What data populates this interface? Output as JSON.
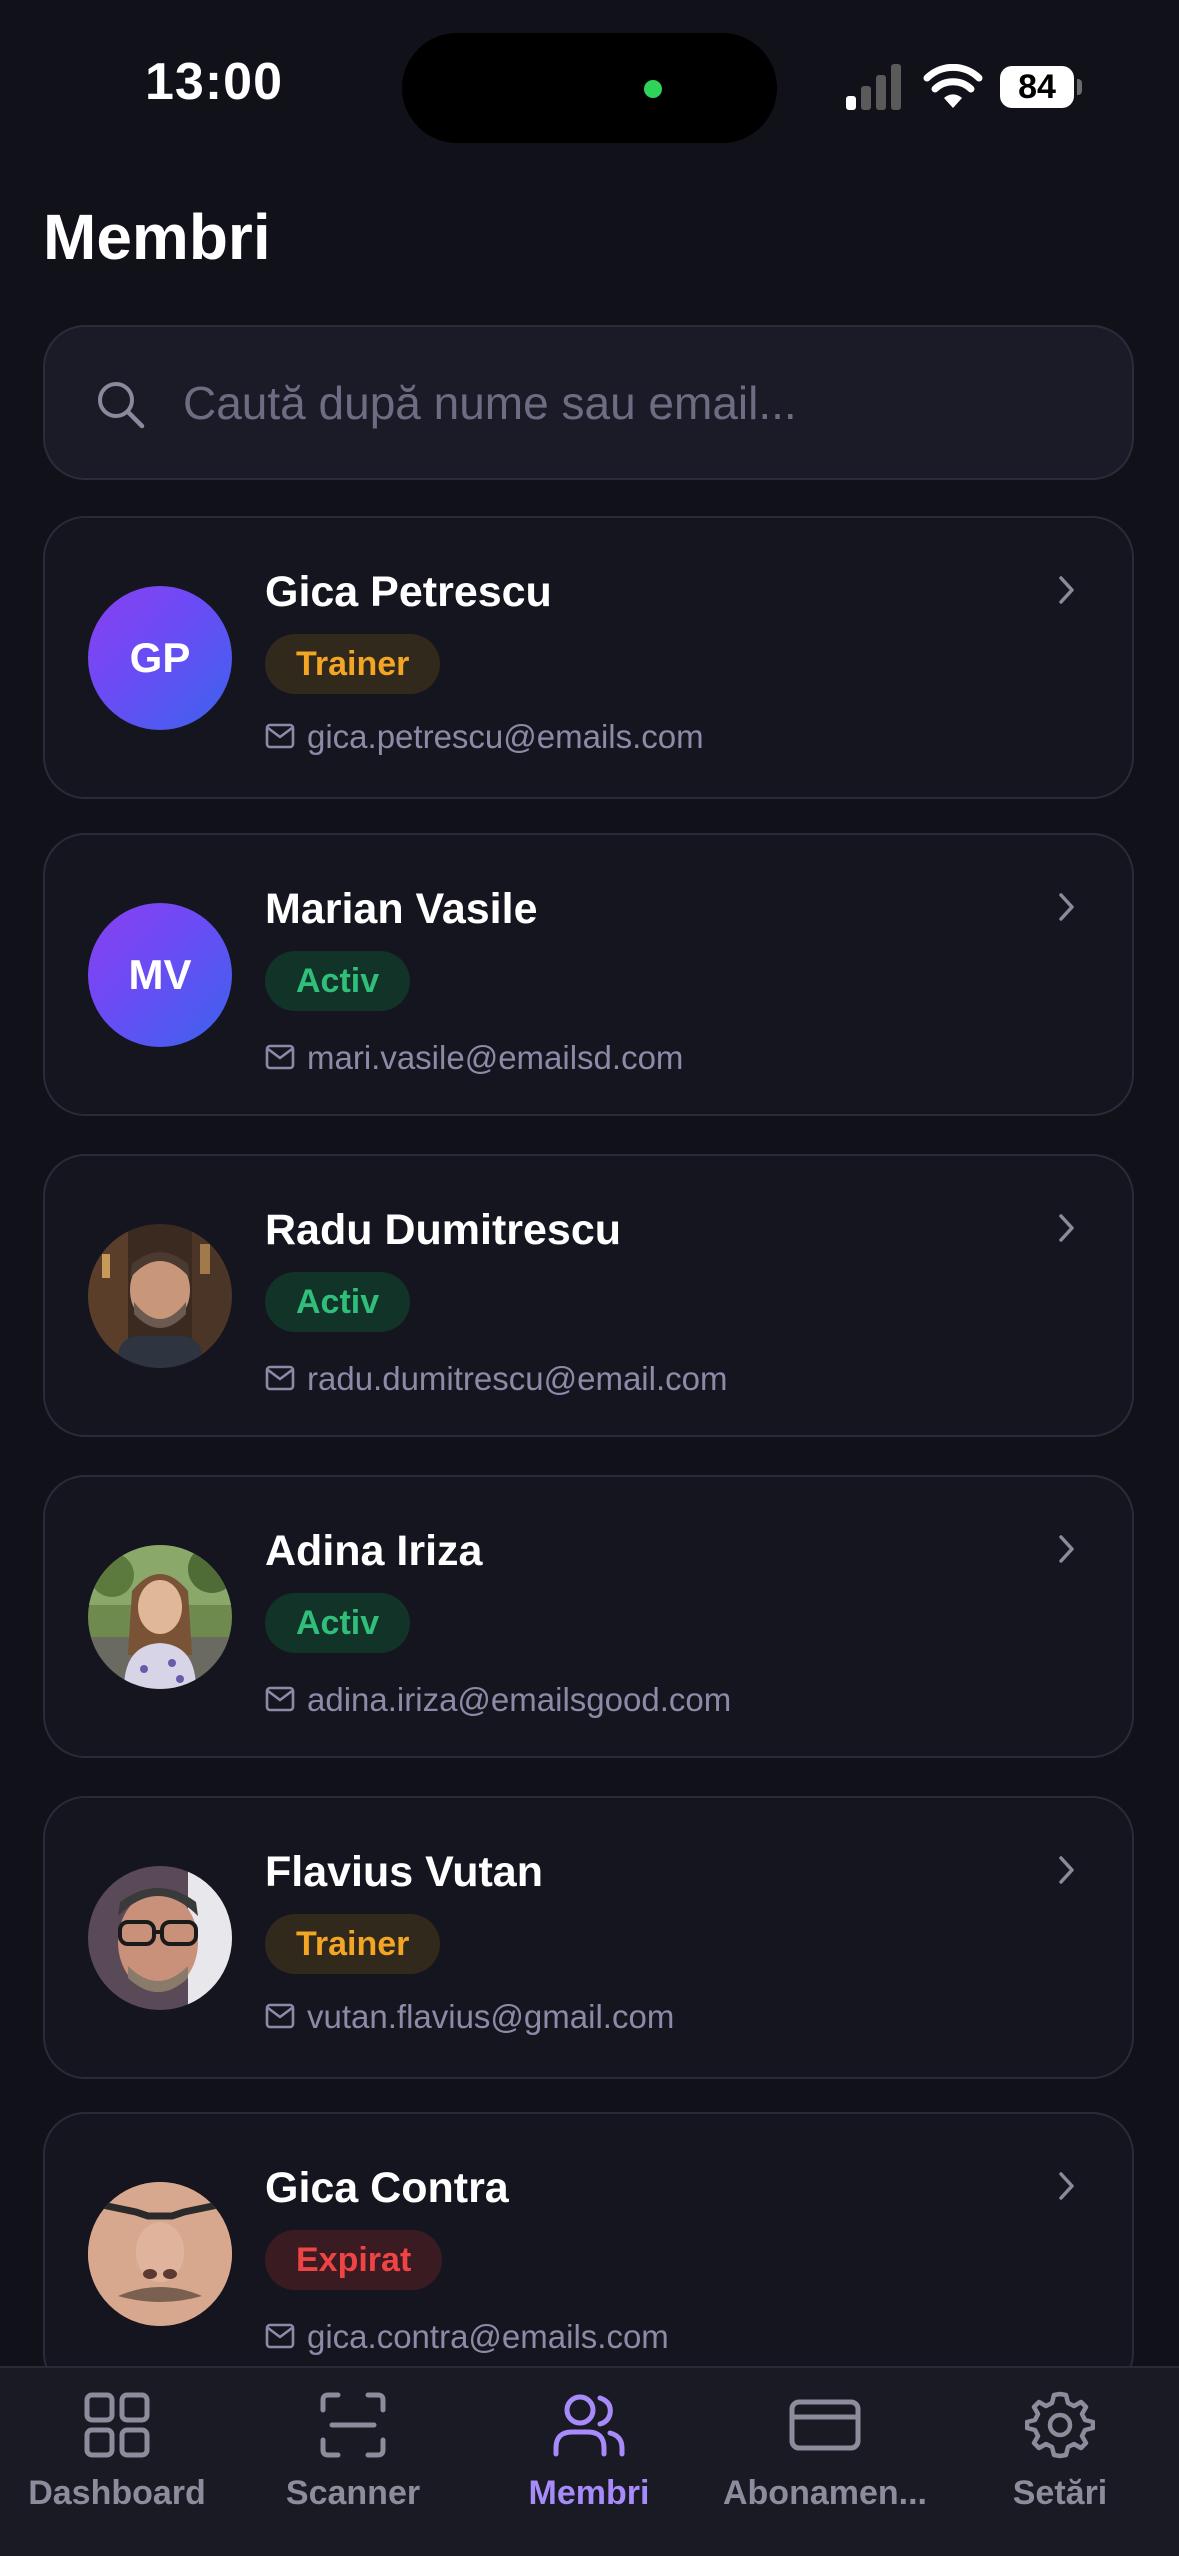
{
  "status_bar": {
    "time": "13:00",
    "battery": "84"
  },
  "page": {
    "title": "Membri"
  },
  "search": {
    "placeholder": "Caută după nume sau email...",
    "value": ""
  },
  "members": [
    {
      "name": "Gica Petrescu",
      "initials": "GP",
      "has_photo": false,
      "role": "Trainer",
      "email": "gica.petrescu@emails.com"
    },
    {
      "name": "Marian Vasile",
      "initials": "MV",
      "has_photo": false,
      "role": "Activ",
      "email": "mari.vasile@emailsd.com"
    },
    {
      "name": "Radu Dumitrescu",
      "has_photo": true,
      "role": "Activ",
      "email": "radu.dumitrescu@email.com"
    },
    {
      "name": "Adina Iriza",
      "has_photo": true,
      "role": "Activ",
      "email": "adina.iriza@emailsgood.com"
    },
    {
      "name": "Flavius Vutan",
      "has_photo": true,
      "role": "Trainer",
      "email": "vutan.flavius@gmail.com"
    },
    {
      "name": "Gica Contra",
      "has_photo": true,
      "role": "Expirat",
      "email": "gica.contra@emails.com"
    }
  ],
  "colors": {
    "background": "#11111a",
    "card": "#151520",
    "accent": "#a78bfa",
    "trainer": "#f5a524",
    "activ": "#2fbf7a",
    "expirat": "#ef4444"
  },
  "tab_bar": {
    "active": "Membri",
    "tabs": [
      {
        "label": "Dashboard",
        "icon": "dashboard-grid-icon"
      },
      {
        "label": "Scanner",
        "icon": "scanner-icon"
      },
      {
        "label": "Membri",
        "icon": "users-icon"
      },
      {
        "label": "Abonamen...",
        "icon": "credit-card-icon"
      },
      {
        "label": "Setări",
        "icon": "gear-icon"
      }
    ]
  }
}
